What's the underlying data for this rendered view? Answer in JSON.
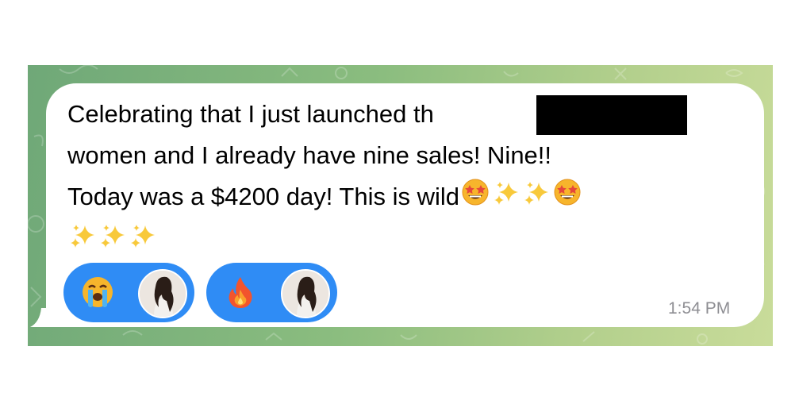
{
  "message": {
    "lines": [
      "Celebrating that I just launched th",
      "women and I already have nine sales! Nine!!",
      "Today was a $4200 day! This is wild"
    ],
    "line3_emojis": [
      "star-struck",
      "sparkles",
      "sparkles",
      "star-struck"
    ],
    "line4_emojis": [
      "sparkles",
      "sparkles",
      "sparkles"
    ],
    "timestamp": "1:54 PM"
  },
  "reactions": [
    {
      "emoji": "loudly-crying-face"
    },
    {
      "emoji": "fire"
    }
  ],
  "colors": {
    "bubble": "#ffffff",
    "reaction_pill": "#2f8cf5",
    "timestamp": "#8e8e93",
    "background": "#8bbd7f"
  }
}
